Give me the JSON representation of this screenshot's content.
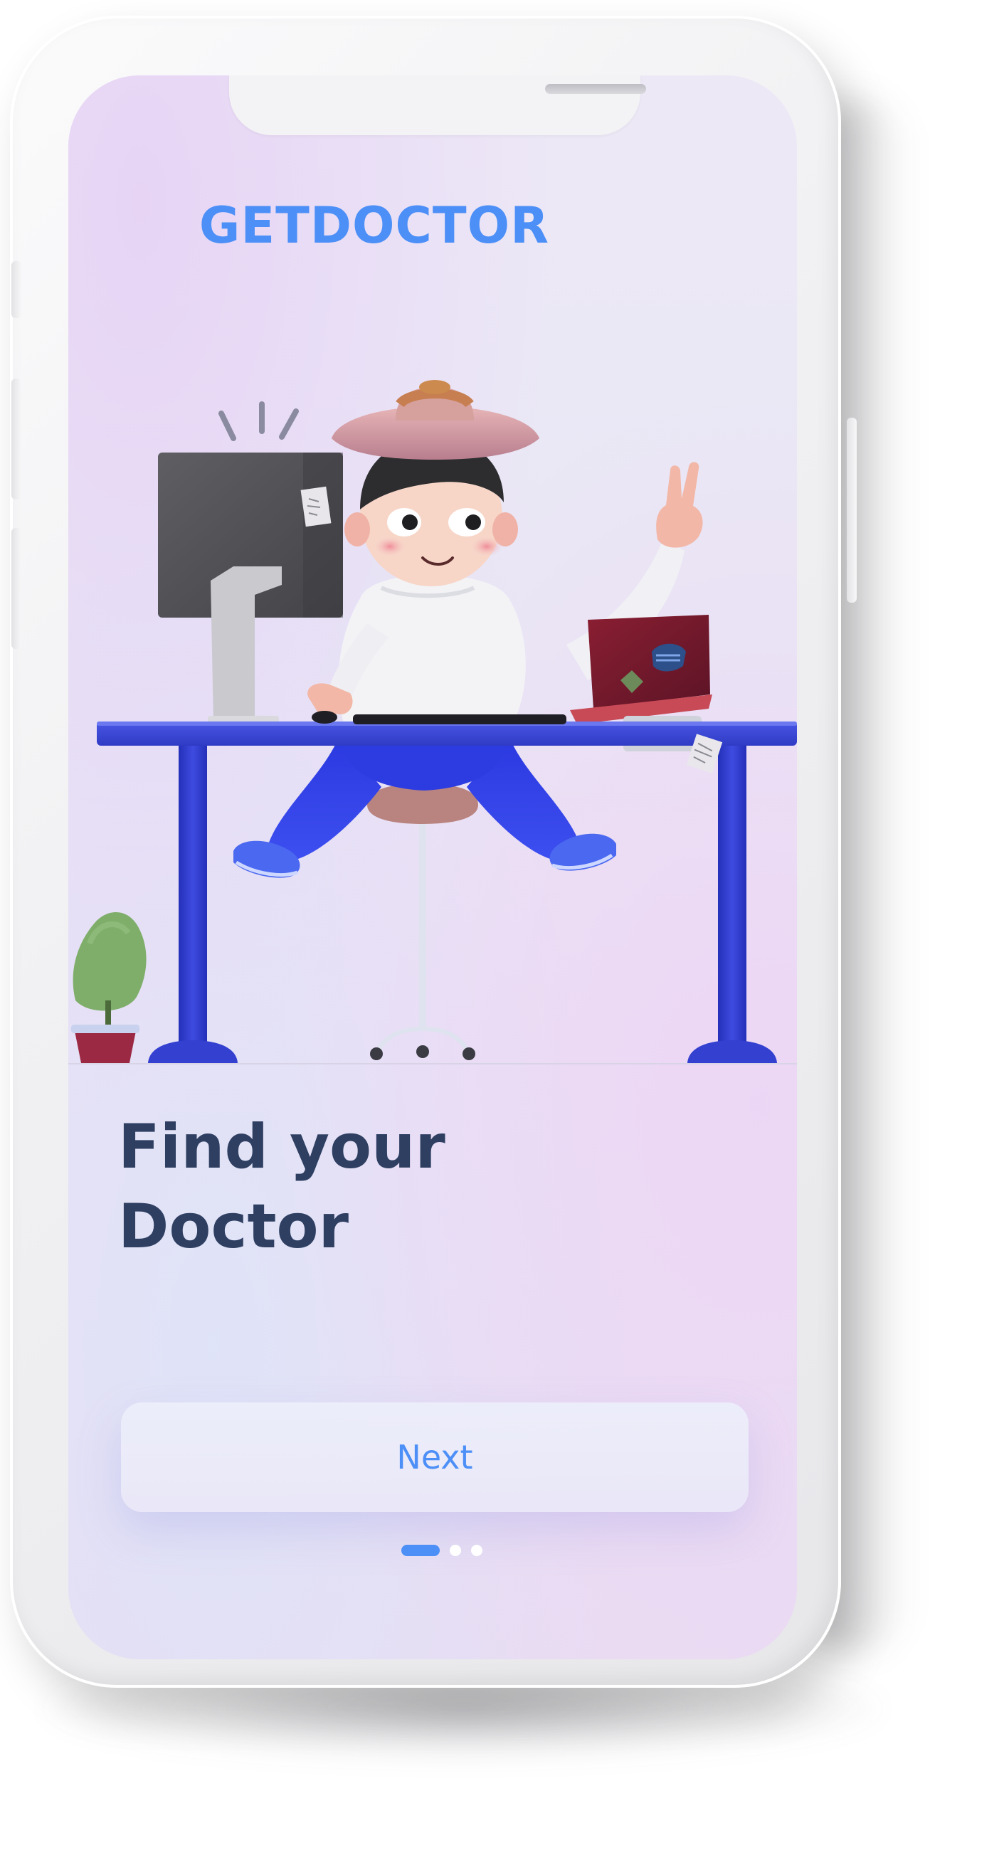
{
  "app": {
    "brand": "GETDOCTOR"
  },
  "onboarding": {
    "headline_line1": "Find your",
    "headline_line2": "Doctor",
    "next_label": "Next",
    "page_indicator": {
      "current": 1,
      "total": 3
    },
    "illustration": "person-at-desk-illustration"
  },
  "colors": {
    "accent": "#4c8ff7",
    "headline": "#2e3f62",
    "desk": "#3b47d9",
    "background_tint": "#ece4f5"
  }
}
